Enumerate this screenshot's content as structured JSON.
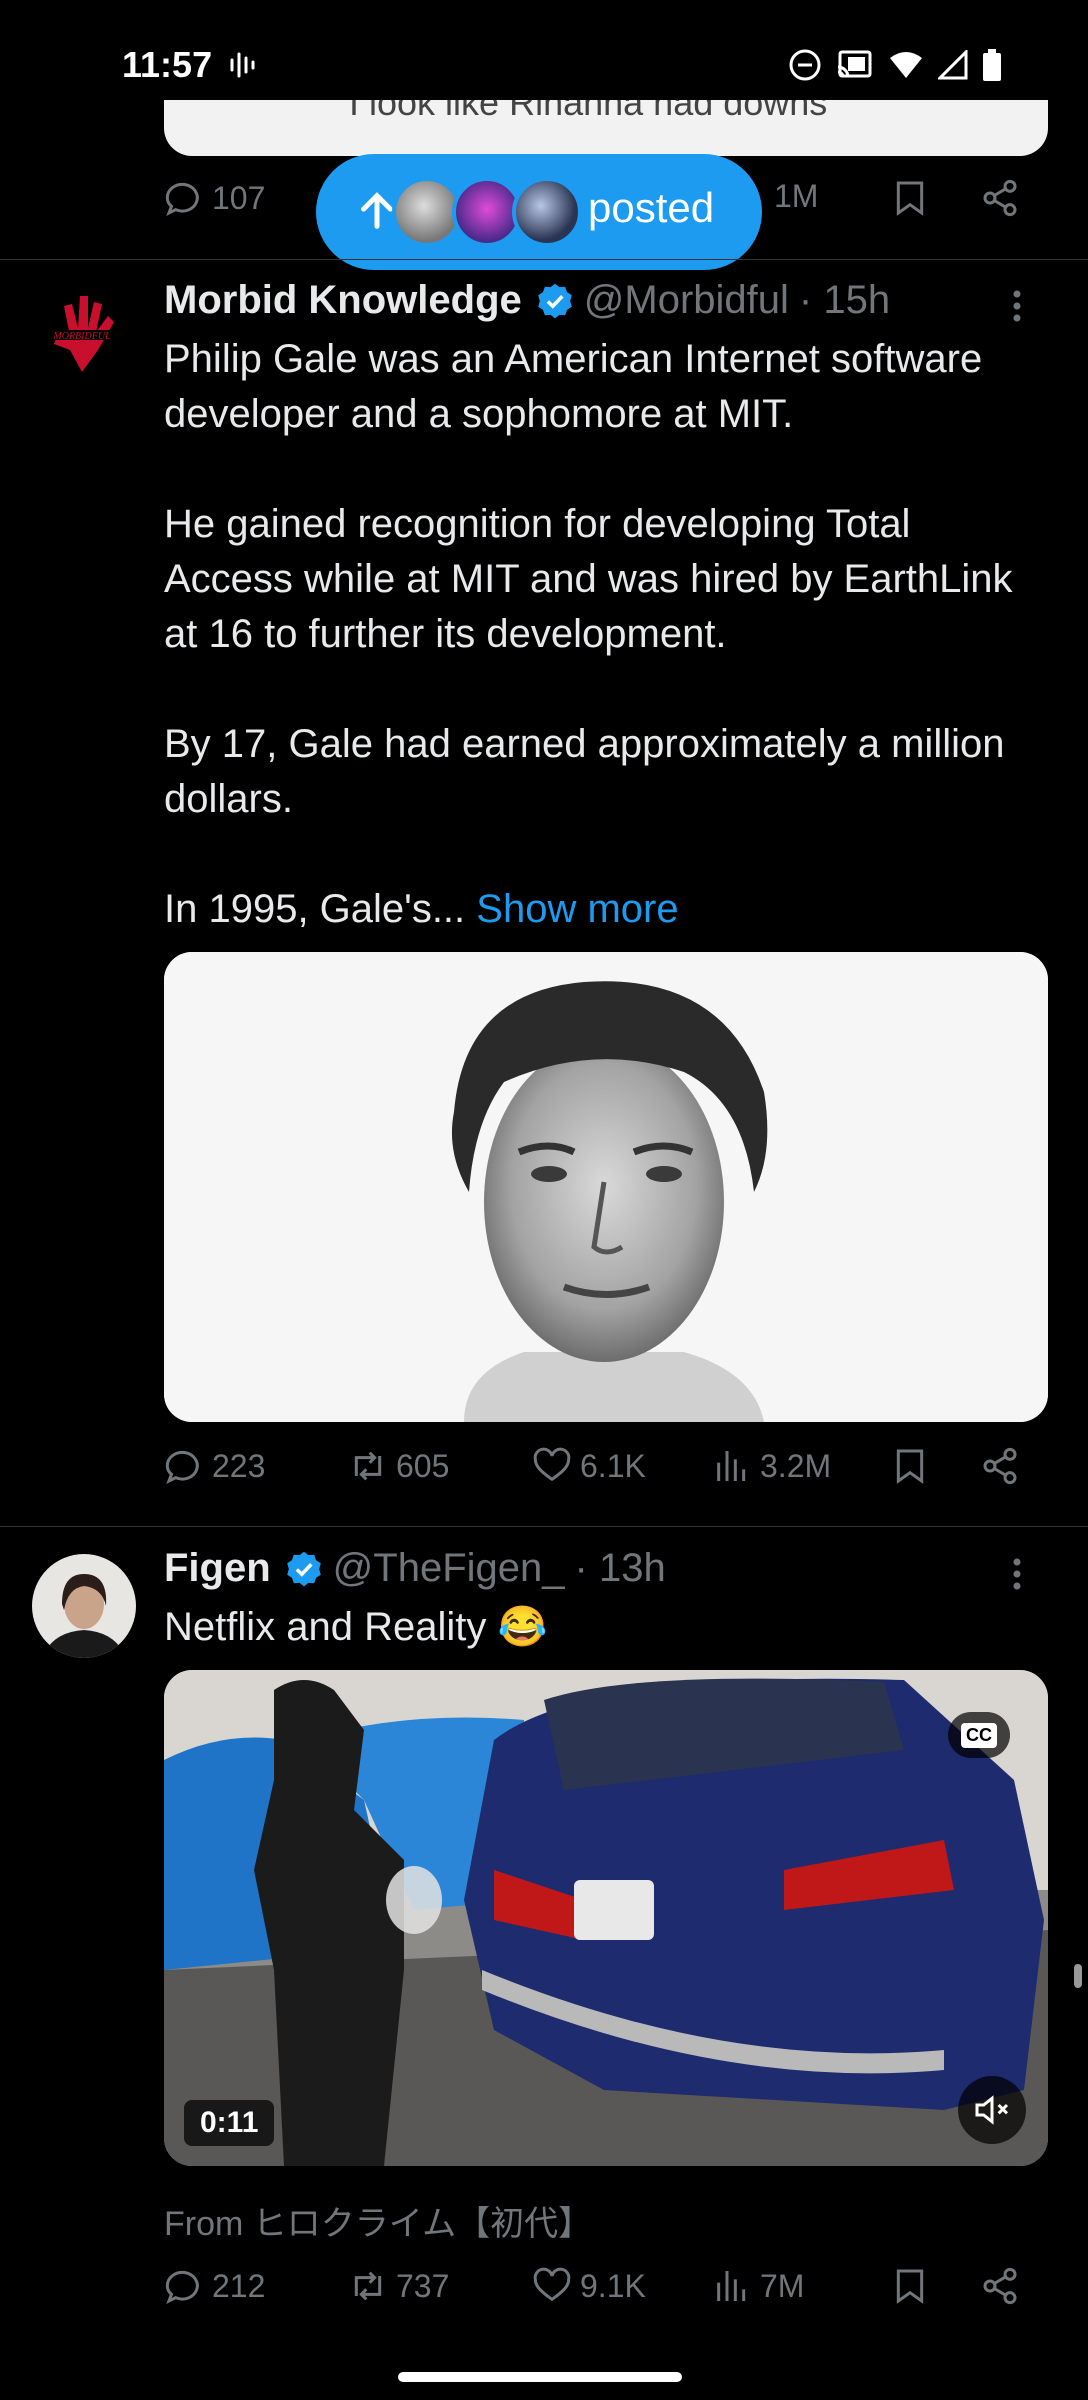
{
  "status_bar": {
    "time": "11:57"
  },
  "prev_tweet": {
    "media_caption": "I look like Rihanna had downs",
    "replies": "107",
    "views": "1M"
  },
  "posted_pill": {
    "label": "posted"
  },
  "tweets": [
    {
      "name": "Morbid Knowledge",
      "handle": "@Morbidful",
      "time": "· 15h",
      "text": "Philip Gale was an American Internet software developer and a sophomore at MIT.\n\nHe gained recognition for developing Total Access while at MIT and was hired by EarthLink at 16 to further its development.\n\nBy 17, Gale had earned approximately a million dollars.\n\nIn 1995, Gale's...",
      "show_more": "Show more",
      "replies": "223",
      "reposts": "605",
      "likes": "6.1K",
      "views": "3.2M"
    },
    {
      "name": "Figen",
      "handle": "@TheFigen_",
      "time": "· 13h",
      "text": "Netflix and Reality 😂",
      "video_time": "0:11",
      "cc": "CC",
      "from": "From ヒロクライム【初代】",
      "replies": "212",
      "reposts": "737",
      "likes": "9.1K",
      "views": "7M"
    }
  ],
  "colors": {
    "accent": "#1d9bf0",
    "secondary_text": "#71767b",
    "background": "#000000"
  }
}
